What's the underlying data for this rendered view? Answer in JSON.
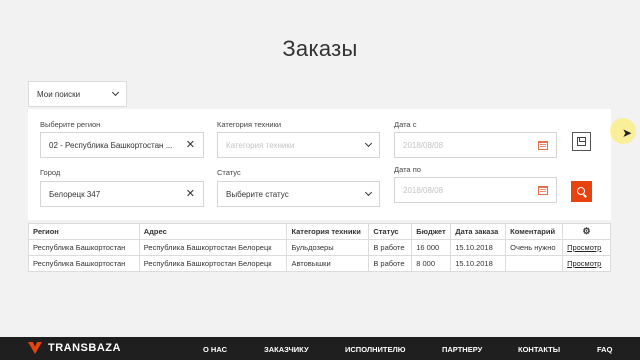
{
  "page": {
    "title": "Заказы"
  },
  "my_search": {
    "label": "Мои поиски"
  },
  "filters": {
    "region": {
      "label": "Выберите регион",
      "value": "02 - Республика Башкортостан ..."
    },
    "city": {
      "label": "Город",
      "value": "Белорецк 347"
    },
    "category": {
      "label": "Категория техники",
      "placeholder": "Категория техники"
    },
    "status": {
      "label": "Статус",
      "value": "Выберите статус"
    },
    "date_from": {
      "label": "Дата с",
      "placeholder": "2018/08/08"
    },
    "date_to": {
      "label": "Дата по",
      "placeholder": "2018/08/08"
    }
  },
  "table": {
    "headers": [
      "Регион",
      "Адрес",
      "Категория техники",
      "Статус",
      "Бюджет",
      "Дата заказа",
      "Коментарий"
    ],
    "rows": [
      {
        "region": "Республика Башкортостан",
        "address": "Республика Башкортостан Белорецк",
        "category": "Бульдозеры",
        "status": "В работе",
        "budget": "16 000",
        "date": "15.10.2018",
        "comment": "Очень нужно",
        "action": "Просмотр"
      },
      {
        "region": "Республика Башкортостан",
        "address": "Республика Башкортостан Белорецк",
        "category": "Автовышки",
        "status": "В работе",
        "budget": "8 000",
        "date": "15.10.2018",
        "comment": "",
        "action": "Просмотр"
      }
    ]
  },
  "footer": {
    "logo": "TRANSBAZA",
    "nav": [
      "О НАС",
      "ЗАКАЗЧИКУ",
      "ИСПОЛНИТЕЛЮ",
      "ПАРТНЕРУ",
      "КОНТАКТЫ",
      "FAQ"
    ]
  },
  "colors": {
    "accent": "#e8430f",
    "footer_bg": "#1f1f1f",
    "page_bg": "#f2f2f2"
  },
  "icons": [
    "chevron-down-icon",
    "clear-icon",
    "calendar-icon",
    "save-icon",
    "search-icon",
    "gear-icon",
    "cursor-icon"
  ]
}
